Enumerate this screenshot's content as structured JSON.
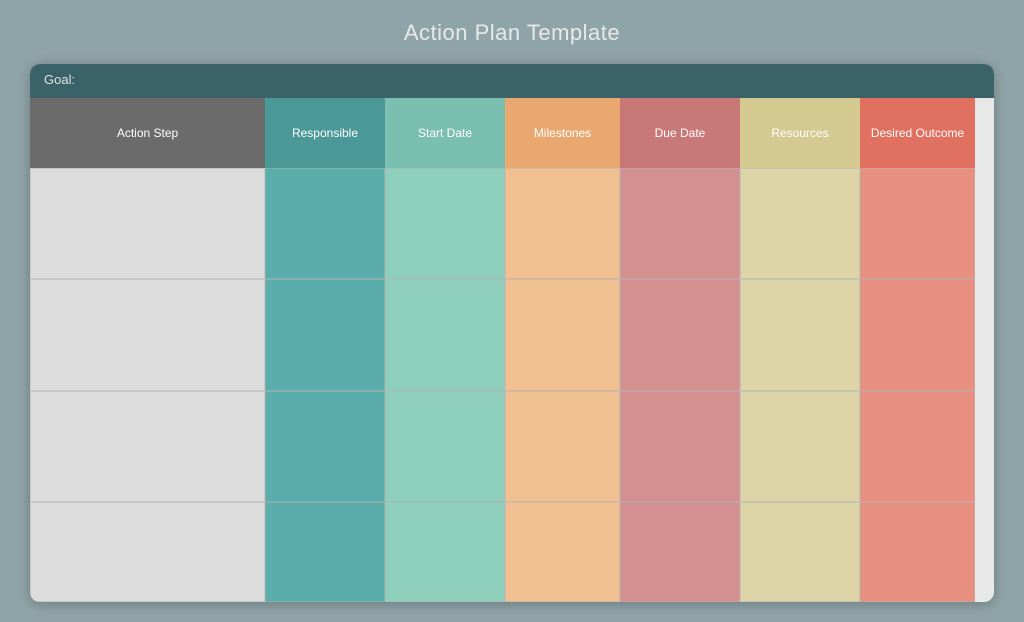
{
  "title": "Action Plan Template",
  "goal_label": "Goal:",
  "columns": [
    {
      "key": "action",
      "label": "Action Step"
    },
    {
      "key": "responsible",
      "label": "Responsible"
    },
    {
      "key": "startdate",
      "label": "Start Date"
    },
    {
      "key": "milestones",
      "label": "Milestones"
    },
    {
      "key": "duedate",
      "label": "Due Date"
    },
    {
      "key": "resources",
      "label": "Resources"
    },
    {
      "key": "desired",
      "label": "Desired Outcome"
    }
  ],
  "num_rows": 4
}
